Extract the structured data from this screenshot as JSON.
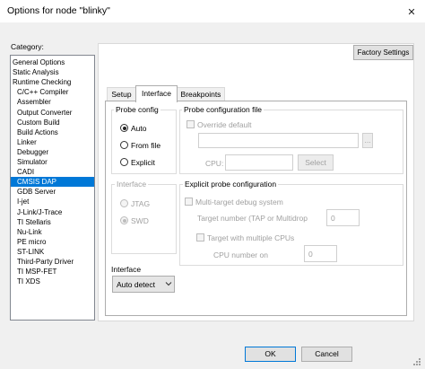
{
  "window": {
    "title": "Options for node \"blinky\"",
    "close_glyph": "✕"
  },
  "category": {
    "label": "Category:",
    "selected_index": 14,
    "items": [
      {
        "label": "General Options",
        "child": false
      },
      {
        "label": "Static Analysis",
        "child": false
      },
      {
        "label": "Runtime Checking",
        "child": false
      },
      {
        "label": "C/C++ Compiler",
        "child": true
      },
      {
        "label": "Assembler",
        "child": true
      },
      {
        "label": "Output Converter",
        "child": true
      },
      {
        "label": "Custom Build",
        "child": true
      },
      {
        "label": "Build Actions",
        "child": true
      },
      {
        "label": "Linker",
        "child": true
      },
      {
        "label": "Debugger",
        "child": true
      },
      {
        "label": "Simulator",
        "child": true
      },
      {
        "label": "CADI",
        "child": true
      },
      {
        "label": "CMSIS DAP",
        "child": true
      },
      {
        "label": "GDB Server",
        "child": true
      },
      {
        "label": "I-jet",
        "child": true
      },
      {
        "label": "J-Link/J-Trace",
        "child": true
      },
      {
        "label": "TI Stellaris",
        "child": true
      },
      {
        "label": "Nu-Link",
        "child": true
      },
      {
        "label": "PE micro",
        "child": true
      },
      {
        "label": "ST-LINK",
        "child": true
      },
      {
        "label": "Third-Party Driver",
        "child": true
      },
      {
        "label": "TI MSP-FET",
        "child": true
      },
      {
        "label": "TI XDS",
        "child": true
      }
    ]
  },
  "factory_settings_label": "Factory Settings",
  "tabs": {
    "setup": "Setup",
    "interface": "Interface",
    "breakpoints": "Breakpoints",
    "active": "interface"
  },
  "probe_config": {
    "title": "Probe config",
    "options": {
      "auto": "Auto",
      "from_file": "From file",
      "explicit": "Explicit"
    },
    "selected": "auto"
  },
  "probe_file": {
    "title": "Probe configuration file",
    "override_label": "Override default",
    "path_value": "",
    "browse_label": "...",
    "cpu_label": "CPU:",
    "cpu_value": "",
    "select_label": "Select"
  },
  "interface_group": {
    "title": "Interface",
    "jtag": "JTAG",
    "swd": "SWD",
    "selected": "swd"
  },
  "explicit_probe": {
    "title": "Explicit probe configuration",
    "multi_target_label": "Multi-target debug system",
    "target_number_label": "Target number (TAP or Multidrop",
    "target_number_value": "0",
    "multi_cpu_label": "Target with multiple CPUs",
    "cpu_number_label": "CPU number on",
    "cpu_number_value": "0"
  },
  "interface_select": {
    "label": "Interface",
    "value": "Auto detect"
  },
  "buttons": {
    "ok": "OK",
    "cancel": "Cancel"
  }
}
